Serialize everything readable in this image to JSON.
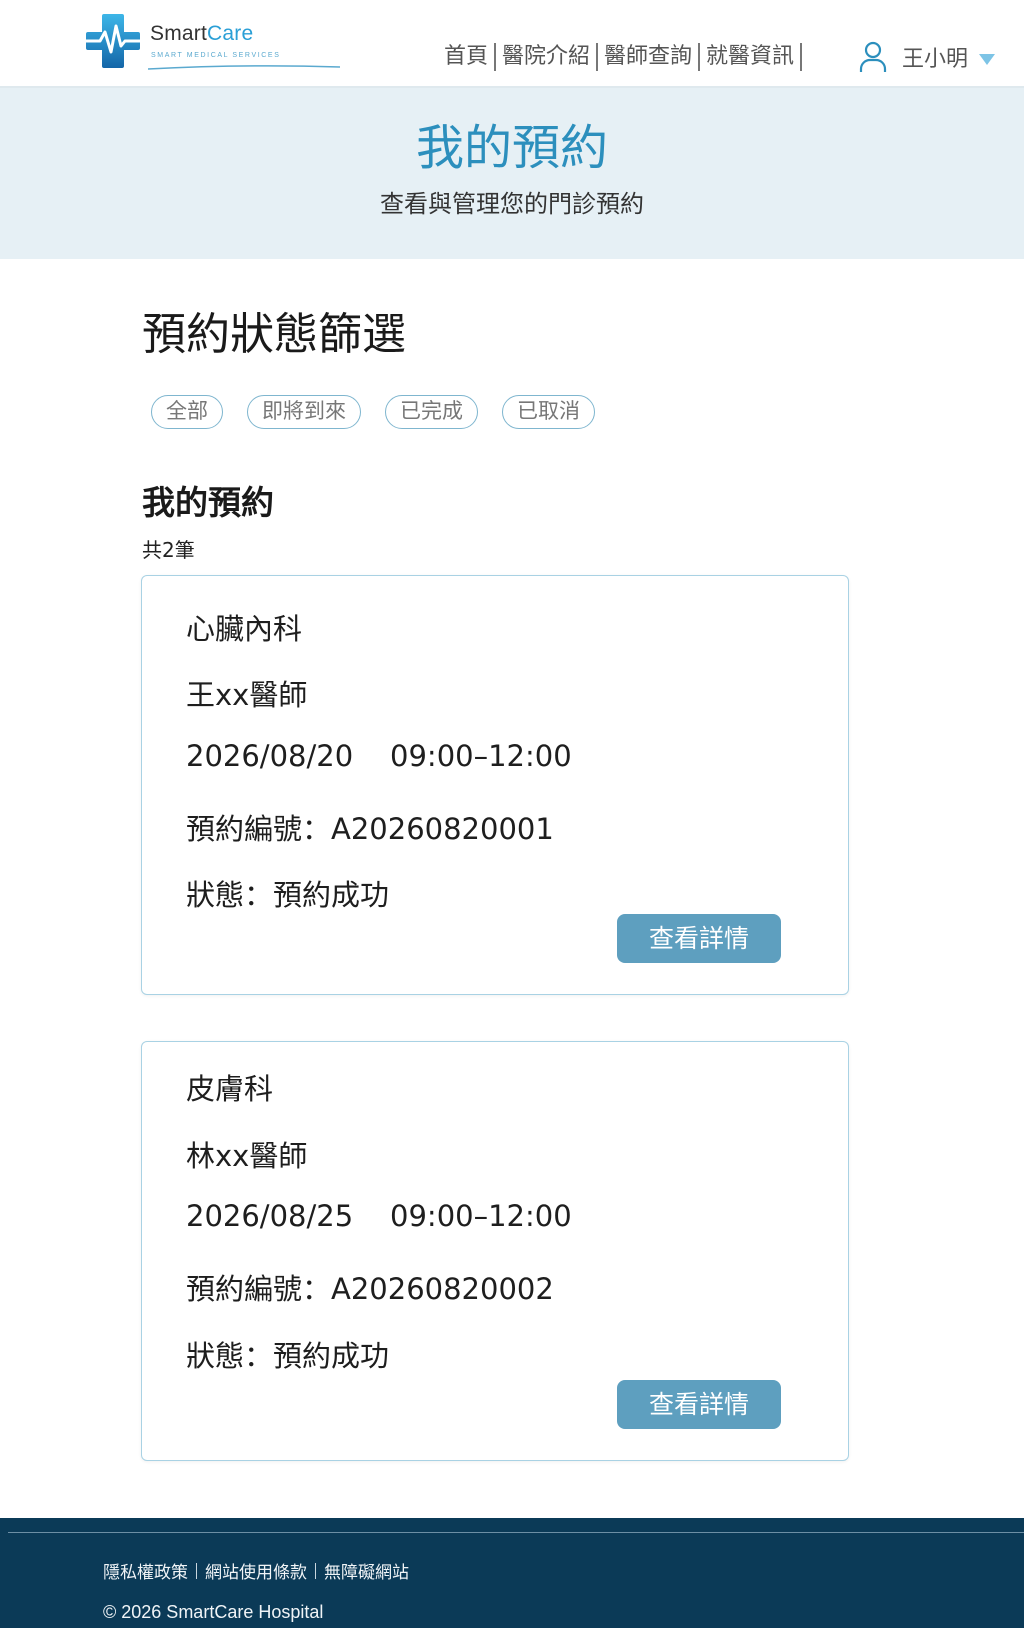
{
  "brand": {
    "name_part1": "Smart",
    "name_part2": "Care",
    "tagline": "SMART MEDICAL SERVICES",
    "color_primary": "#2a9fd6",
    "color_dark": "#1466a8"
  },
  "nav": {
    "items": [
      {
        "label": "首頁"
      },
      {
        "label": "醫院介紹"
      },
      {
        "label": "醫師查詢"
      },
      {
        "label": "就醫資訊"
      }
    ],
    "user_name": "王小明",
    "user_icon": "user-icon",
    "caret_icon": "caret-down-icon"
  },
  "hero": {
    "title": "我的預約",
    "subtitle": "查看與管理您的門診預約",
    "background": "#e6f0f5",
    "title_color": "#2c8fbd"
  },
  "filter": {
    "title": "預約狀態篩選",
    "options": [
      {
        "label": "全部"
      },
      {
        "label": "即將到來"
      },
      {
        "label": "已完成"
      },
      {
        "label": "已取消"
      }
    ]
  },
  "list": {
    "title": "我的預約",
    "count": "共2筆"
  },
  "appointments": [
    {
      "department": "心臟內科",
      "doctor": "王xx醫師",
      "datetime": "2026/08/20    09:00–12:00",
      "booking_no": "預約編號：A20260820001",
      "status": "狀態：預約成功",
      "button": "查看詳情"
    },
    {
      "department": "皮膚科",
      "doctor": "林xx醫師",
      "datetime": "2026/08/25    09:00–12:00",
      "booking_no": "預約編號：A20260820002",
      "status": "狀態：預約成功",
      "button": "查看詳情"
    }
  ],
  "footer": {
    "links": [
      {
        "label": "隱私權政策"
      },
      {
        "label": "網站使用條款"
      },
      {
        "label": "無障礙網站"
      }
    ],
    "copyright": "© 2026 SmartCare Hospital",
    "background": "#0b3a57"
  }
}
